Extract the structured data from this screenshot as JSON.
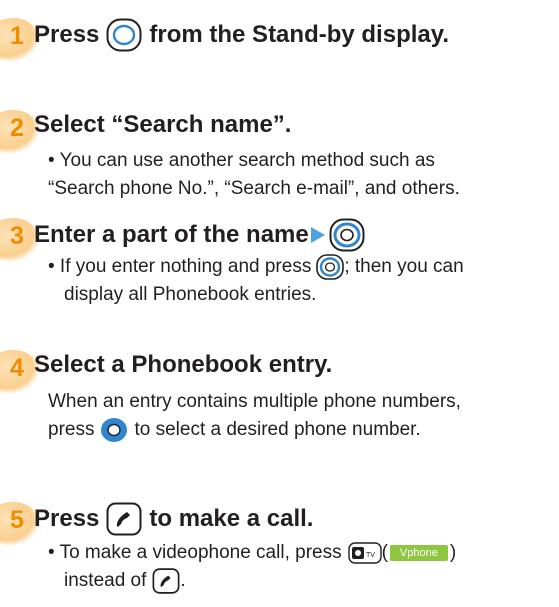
{
  "steps": [
    {
      "number": "1",
      "title_before": "Press",
      "title_after": "from the Stand-by display."
    },
    {
      "number": "2",
      "title": "Select “Search name”.",
      "bullet_line1": "• You can use another search method such as",
      "bullet_line2": "“Search phone No.”, “Search e-mail”, and others."
    },
    {
      "number": "3",
      "title": "Enter a part of the name",
      "bullet_line1_before": "• If you enter nothing and press",
      "bullet_line1_after": "; then you can",
      "bullet_line2": "display all Phonebook entries."
    },
    {
      "number": "4",
      "title": "Select a Phonebook entry.",
      "text_line1": "When an entry contains multiple phone numbers,",
      "text_line2_before": "press",
      "text_line2_after": "to select a desired phone number."
    },
    {
      "number": "5",
      "title_before": "Press",
      "title_after": "to make a call.",
      "bullet_line1_before": "• To make a videophone call, press",
      "paren_open": "(",
      "softkey_label": "Vphone",
      "paren_close": ")",
      "bullet_line2_before": "instead of",
      "bullet_line2_after": "."
    }
  ],
  "icons": {
    "menu_key": "circle-o-key-icon",
    "navigation_key": "blue-navigation-key-icon",
    "call_key": "phone-handset-key-icon",
    "camera_tv_key": "camera-tv-key-icon",
    "arrow": "blue-arrow-icon"
  },
  "colors": {
    "step_number": "#f08c00",
    "nav_key_blue": "#2e86d1",
    "softkey_green": "#8dc63f",
    "arrow_blue": "#4da3e0"
  },
  "camera_key_label": "TV"
}
